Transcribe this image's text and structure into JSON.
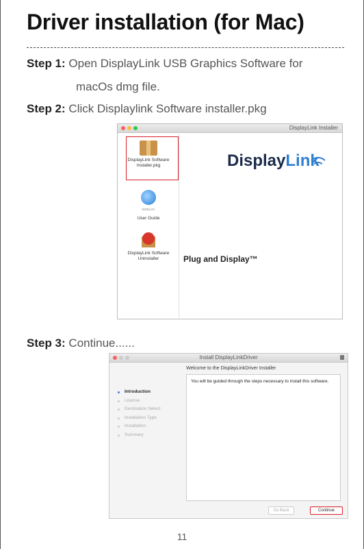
{
  "title": "Driver installation (for Mac)",
  "steps": [
    {
      "label": "Step 1:",
      "text": "Open DisplayLink USB Graphics Software for",
      "cont": "macOs dmg file."
    },
    {
      "label": "Step 2:",
      "text": "Click Displaylink Software installer.pkg"
    },
    {
      "label": "Step 3:",
      "text": "Continue......"
    }
  ],
  "window1": {
    "title": "DisplayLink Installer",
    "items": [
      {
        "label_line1": "DisplayLink Software",
        "label_line2": "Installer.pkg"
      },
      {
        "label_line1": "WEBLOC",
        "label_line2": "User Guide"
      },
      {
        "label_line1": "DisplayLink Software",
        "label_line2": "Uninstaller"
      }
    ],
    "logo_main": "Display",
    "logo_accent": "Link",
    "tagline": "Plug and Display™"
  },
  "window2": {
    "title": "Install DisplayLinkDriver",
    "heading": "Welcome to the DisplayLinkDriver Installer",
    "nav": [
      "Introduction",
      "License",
      "Destination Select",
      "Installation Type",
      "Installation",
      "Summary"
    ],
    "message": "You will be guided through the steps necessary to install this software.",
    "back_label": "Go Back",
    "continue_label": "Continue"
  },
  "page_number": "11"
}
